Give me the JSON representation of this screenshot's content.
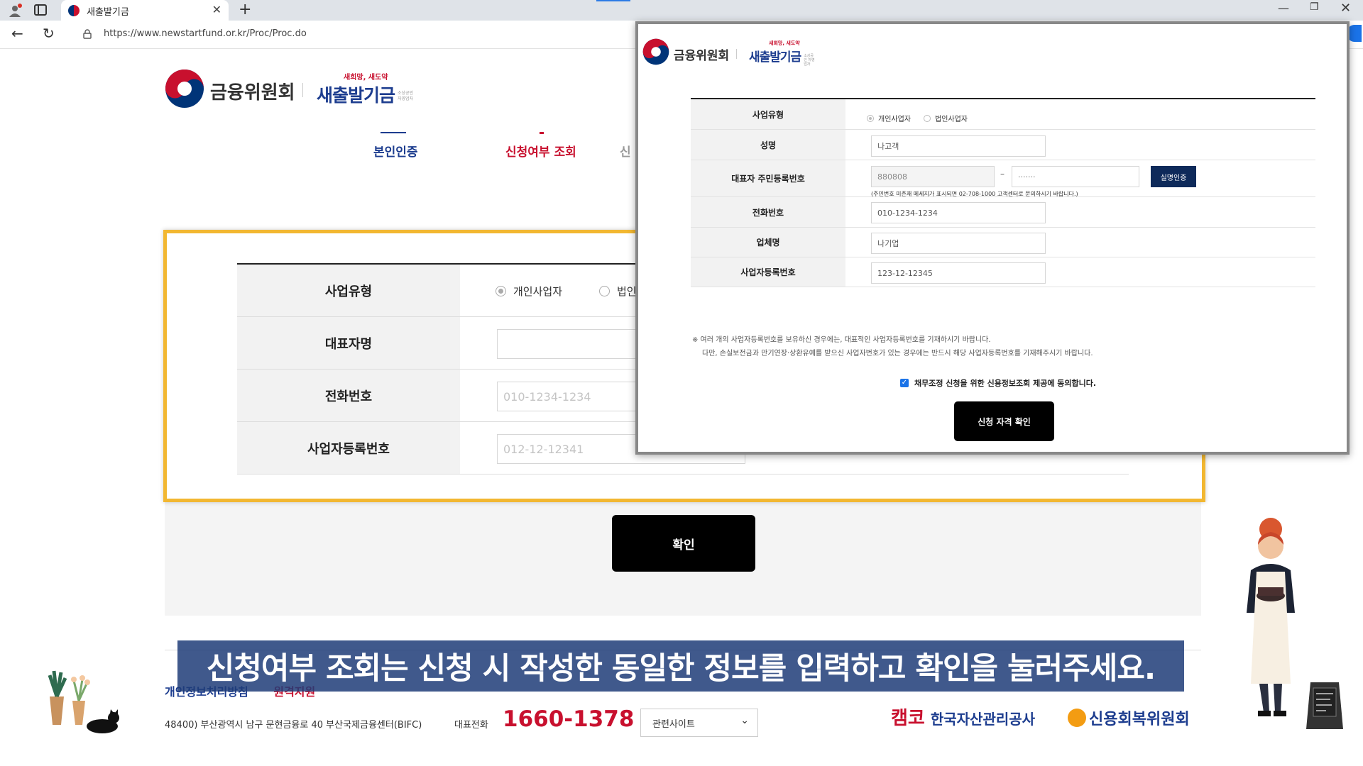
{
  "browser": {
    "tab_title": "새출발기금",
    "url": "https://www.newstartfund.or.kr/Proc/Proc.do",
    "new_tab": "+",
    "close": "✕",
    "min": "—",
    "max": "❐",
    "win_close": "✕"
  },
  "header": {
    "org_name": "금융위원회",
    "fund_sub": "새희망, 새도약",
    "fund_name": "새출발기금",
    "fund_small": "소상공인 자영업자"
  },
  "steps": [
    "본인인증",
    "신청여부 조회",
    "신"
  ],
  "bg_form": {
    "rows": [
      {
        "label": "사업유형",
        "radios": [
          "개인사업자",
          "법인"
        ]
      },
      {
        "label": "대표자명",
        "value": ""
      },
      {
        "label": "전화번호",
        "placeholder": "010-1234-1234"
      },
      {
        "label": "사업자등록번호",
        "placeholder": "012-12-12341"
      }
    ],
    "confirm": "확인"
  },
  "footer": {
    "privacy": "개인정보처리방침",
    "remote": "원격지원",
    "address": "48400) 부산광역시 남구 문현금융로 40 부산국제금융센터(BIFC)",
    "tel_label": "대표전화",
    "tel": "1660-1378",
    "related": "관련사이트",
    "kamco_mark": "캠코",
    "kamco": "한국자산관리공사",
    "ccrs": "신용회복위원회"
  },
  "subtitle": "신청여부 조회는 신청 시 작성한 동일한 정보를 입력하고 확인을 눌러주세요.",
  "popup": {
    "org_name": "금융위원회",
    "fund_sub": "새희망, 새도약",
    "fund_name": "새출발기금",
    "fund_small": "소상공인 자영업자",
    "rows": {
      "biz_type": {
        "label": "사업유형",
        "opt1": "개인사업자",
        "opt2": "법인사업자"
      },
      "name": {
        "label": "성명",
        "value": "나고객"
      },
      "rrn": {
        "label": "대표자 주민등록번호",
        "front": "880808",
        "back": "·······",
        "verify": "실명인증",
        "note": "(주민번호 미존재 메세지가 표시되면 02-708-1000 고객센터로 문의하시기 바랍니다.)"
      },
      "phone": {
        "label": "전화번호",
        "value": "010-1234-1234"
      },
      "company": {
        "label": "업체명",
        "value": "나기업"
      },
      "bizno": {
        "label": "사업자등록번호",
        "value": "123-12-12345"
      }
    },
    "notice1": "※ 여러 개의 사업자등록번호를 보유하신 경우에는, 대표적인 사업자등록번호를 기재하시기 바랍니다.",
    "notice2": "다만, 손실보전금과 만기연장·상환유예를 받으신 사업자번호가 있는 경우에는 반드시 해당 사업자등록번호를 기재해주시기 바랍니다.",
    "agree": "채무조정 신청을 위한 신용정보조회 제공에 동의합니다.",
    "submit": "신청 자격 확인"
  }
}
